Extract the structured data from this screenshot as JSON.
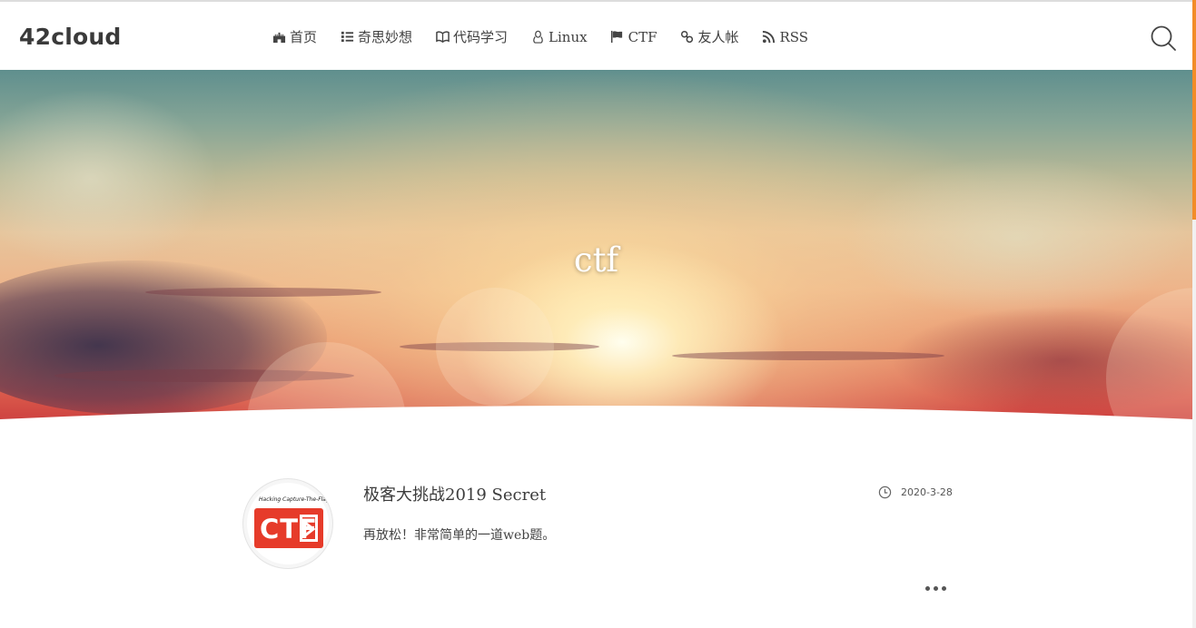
{
  "site": {
    "logo": "42cloud"
  },
  "nav": {
    "items": [
      {
        "label": "首页",
        "icon": "castle-icon"
      },
      {
        "label": "奇思妙想",
        "icon": "list-icon"
      },
      {
        "label": "代码学习",
        "icon": "book-icon"
      },
      {
        "label": "Linux",
        "icon": "linux-icon"
      },
      {
        "label": "CTF",
        "icon": "flag-icon"
      },
      {
        "label": "友人帐",
        "icon": "link-icon"
      },
      {
        "label": "RSS",
        "icon": "rss-icon"
      }
    ],
    "search_icon": "search-icon"
  },
  "hero": {
    "title": "ctf"
  },
  "posts": [
    {
      "title": "极客大挑战2019 Secret",
      "date": "2020-3-28",
      "excerpt": "再放松！非常简单的一道web题。",
      "thumbnail": {
        "caption": "Hacking Capture-The-Flag",
        "logo_text": "CTF"
      }
    }
  ],
  "colors": {
    "accent": "#f28c28",
    "ctf_red": "#e63b2a",
    "text": "#333333"
  }
}
